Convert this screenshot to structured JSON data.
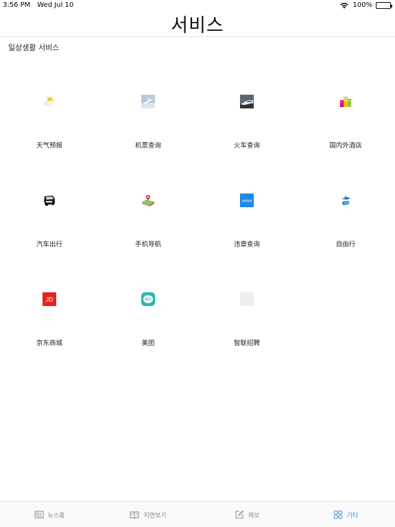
{
  "status_bar": {
    "time": "3:56 PM",
    "date": "Wed Jul 10",
    "battery": "100%"
  },
  "header": {
    "title": "서비스"
  },
  "section": {
    "title": "일상생활 서비스"
  },
  "services": [
    {
      "label": "天气预报",
      "icon": "weather-icon"
    },
    {
      "label": "机票查询",
      "icon": "flight-icon"
    },
    {
      "label": "火车查询",
      "icon": "train-icon"
    },
    {
      "label": "国内外酒店",
      "icon": "hotel-icon"
    },
    {
      "label": "汽车出行",
      "icon": "car-icon"
    },
    {
      "label": "手机导航",
      "icon": "navigation-icon"
    },
    {
      "label": "违章查询",
      "icon": "violation-icon",
      "badge": "违章查询"
    },
    {
      "label": "自由行",
      "icon": "travel-icon"
    },
    {
      "label": "京东商城",
      "icon": "jd-icon",
      "badge": "JD"
    },
    {
      "label": "美团",
      "icon": "meituan-icon",
      "badge": "美团"
    },
    {
      "label": "智联招聘",
      "icon": "zhaopin-icon"
    }
  ],
  "tabs": [
    {
      "label": "뉴스홈",
      "icon": "news-icon"
    },
    {
      "label": "지면보기",
      "icon": "book-icon"
    },
    {
      "label": "제보",
      "icon": "edit-icon"
    },
    {
      "label": "기타",
      "icon": "grid-icon",
      "active": true
    }
  ],
  "colors": {
    "accent": "#3a8ee6",
    "jd_red": "#e1251b",
    "meituan_green": "#2bb8aa"
  }
}
